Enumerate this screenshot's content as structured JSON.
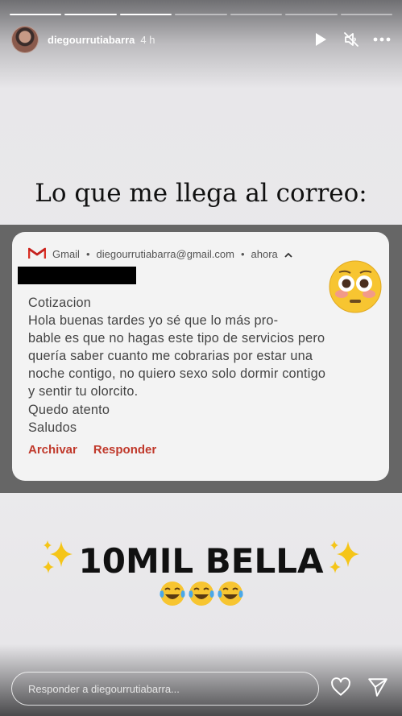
{
  "story": {
    "progress_total": 7,
    "progress_done": 3,
    "username": "diegourrutiabarra",
    "time": "4 h"
  },
  "header_icons": [
    "play-icon",
    "mute-icon",
    "more-icon"
  ],
  "caption": "Lo que me llega al correo:",
  "notification": {
    "app": "Gmail",
    "account": "diegourrutiabarra@gmail.com",
    "when": "ahora",
    "separator": "•",
    "subject": "Cotizacion",
    "lines": [
      "Hola buenas tardes yo sé que lo más pro-",
      "bable es que no hagas este tipo de servicios pero",
      "quería saber cuanto me cobrarias por estar una",
      "noche contigo, no quiero sexo solo dormir contigo",
      "y sentir tu olorcito.",
      "Quedo atento",
      "Saludos"
    ],
    "archive_label": "Archivar",
    "reply_label": "Responder"
  },
  "sticker_text": "10MIL BELLA",
  "reply_bar": {
    "placeholder": "Responder a diegourrutiabarra..."
  },
  "colors": {
    "gmail_red": "#c0392b",
    "text_dark": "#111111"
  }
}
